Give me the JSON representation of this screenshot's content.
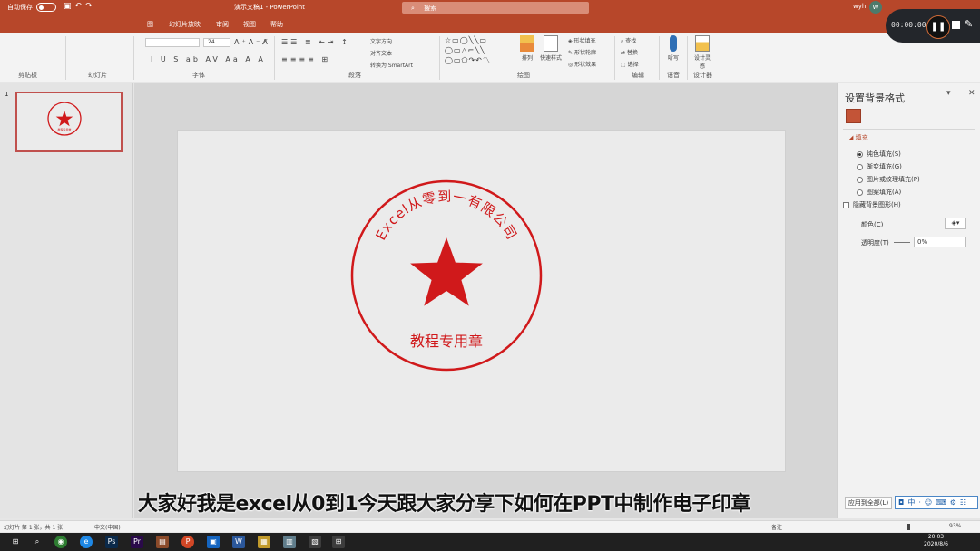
{
  "titlebar": {
    "autosave": "自动保存",
    "doc_title": "演示文稿1 - PowerPoint",
    "search": "搜索",
    "user": "wyh",
    "avatar": "W"
  },
  "ribbon_tabs": [
    "图",
    "幻灯片放映",
    "审阅",
    "视图",
    "帮助"
  ],
  "ribbon": {
    "font_size": "24",
    "text_direction": "文字方向",
    "align_text": "对齐文本",
    "smartart": "转换为 SmartArt",
    "arrange": "排列",
    "quick_styles": "快速样式",
    "shape_fill": "形状填充",
    "shape_outline": "形状轮廓",
    "shape_effects": "形状效果",
    "find": "查找",
    "replace": "替换",
    "select": "选择",
    "dictate": "听写",
    "designer": "设计灵感",
    "groups": {
      "clipboard": "剪贴板",
      "slides": "幻灯片",
      "font": "字体",
      "paragraph": "段落",
      "drawing": "绘图",
      "editing": "编辑",
      "voice": "语音",
      "designer": "设计器"
    }
  },
  "thumbnail": {
    "number": "1"
  },
  "seal": {
    "top_text": "Excel从零到一有限公司",
    "bottom_text": "教程专用章",
    "thumb_text": "教程专用章",
    "color": "#d0191b"
  },
  "format_pane": {
    "title": "设置背景格式",
    "section": "填充",
    "options": [
      "纯色填充(S)",
      "渐变填充(G)",
      "图片或纹理填充(P)",
      "图案填充(A)"
    ],
    "hide_graphics": "隐藏背景图形(H)",
    "color_label": "颜色(C)",
    "transparency_label": "透明度(T)",
    "transparency_value": "0%",
    "apply_all": "应用到全部(L)"
  },
  "recorder": {
    "time": "00:00:00"
  },
  "subtitle": "大家好我是excel从0到1今天跟大家分享下如何在PPT中制作电子印章",
  "statusbar": {
    "slide_info": "幻灯片 第 1 张，共 1 张",
    "language": "中文(中国)",
    "notes": "备注",
    "zoom": "93%"
  },
  "taskbar": {
    "time": "20:03",
    "date": "2020/8/6"
  },
  "colors": {
    "accent": "#b7472a",
    "seal": "#d0191b"
  }
}
